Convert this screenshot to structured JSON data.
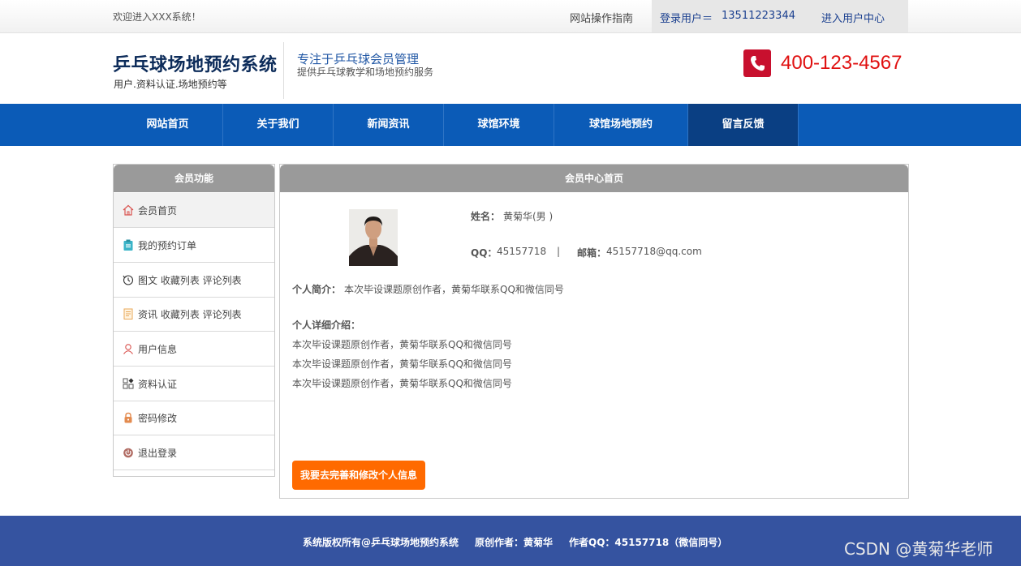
{
  "topbar": {
    "welcome": "欢迎进入XXX系统！",
    "guide": "网站操作指南",
    "user_label": "登录用户＝",
    "user_phone": "13511223344",
    "user_center": "进入用户中心"
  },
  "header": {
    "title": "乒乓球场地预约系统",
    "subtitle": "用户.资料认证.场地预约等",
    "slogan_main": "专注于乒乓球会员管理",
    "slogan_sub": "提供乒乓球教学和场地预约服务",
    "phone": "400-123-4567",
    "phone_icon": "phone-icon",
    "accent_color": "#c8102e"
  },
  "nav": {
    "items": [
      {
        "label": "网站首页"
      },
      {
        "label": "关于我们"
      },
      {
        "label": "新闻资讯"
      },
      {
        "label": "球馆环境"
      },
      {
        "label": "球馆场地预约"
      },
      {
        "label": "留言反馈"
      }
    ],
    "active_index": 5
  },
  "sidebar": {
    "title": "会员功能",
    "items": [
      {
        "label": "会员首页",
        "icon": "home-icon"
      },
      {
        "label": "我的预约订单",
        "icon": "clipboard-icon"
      },
      {
        "label": "图文 收藏列表 评论列表",
        "icon": "history-icon"
      },
      {
        "label": "资讯 收藏列表 评论列表",
        "icon": "document-icon"
      },
      {
        "label": "用户信息",
        "icon": "user-icon"
      },
      {
        "label": "资料认证",
        "icon": "grid-icon"
      },
      {
        "label": "密码修改",
        "icon": "lock-icon"
      },
      {
        "label": "退出登录",
        "icon": "power-icon"
      }
    ]
  },
  "panel": {
    "title": "会员中心首页",
    "name_label": "姓名：",
    "name_value": "黄菊华(男 )",
    "qq_label": "QQ：",
    "qq_value": "45157718",
    "separator": "|",
    "email_label": "邮箱：",
    "email_value": "45157718@qq.com",
    "intro_label": "个人简介：",
    "intro_value": "本次毕设课题原创作者，黄菊华联系QQ和微信同号",
    "detail_label": "个人详细介绍：",
    "detail_lines": [
      "本次毕设课题原创作者，黄菊华联系QQ和微信同号",
      "本次毕设课题原创作者，黄菊华联系QQ和微信同号",
      "本次毕设课题原创作者，黄菊华联系QQ和微信同号"
    ],
    "edit_button": "我要去完善和修改个人信息"
  },
  "footer": {
    "copyright": "系统版权所有@乒乓球场地预约系统",
    "author": "原创作者：黄菊华",
    "qq": "作者QQ：45157718（微信同号）",
    "watermark": "CSDN @黄菊华老师"
  }
}
